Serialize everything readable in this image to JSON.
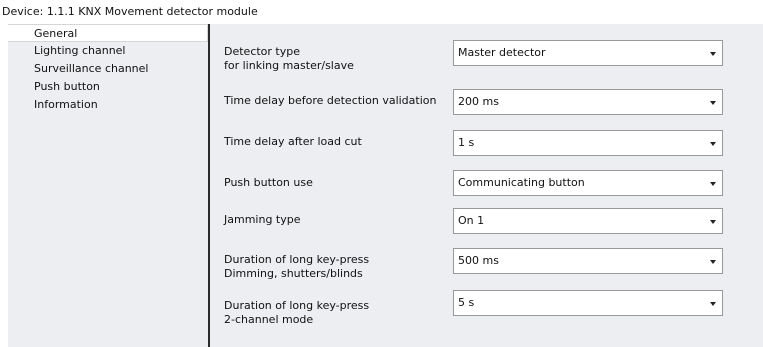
{
  "window": {
    "title": "Device: 1.1.1  KNX Movement detector module"
  },
  "sidebar": {
    "items": [
      {
        "label": "General"
      },
      {
        "label": "Lighting channel"
      },
      {
        "label": "Surveillance channel"
      },
      {
        "label": "Push button"
      },
      {
        "label": "Information"
      }
    ],
    "selected": "General"
  },
  "parameters": [
    {
      "label_line1": "Detector type",
      "label_line2": "for linking master/slave",
      "value": "Master detector"
    },
    {
      "label_line1": "Time delay before detection validation",
      "label_line2": "",
      "value": "200 ms"
    },
    {
      "label_line1": "Time delay after load cut",
      "label_line2": "",
      "value": "1 s"
    },
    {
      "label_line1": "Push button use",
      "label_line2": "",
      "value": "Communicating button"
    },
    {
      "label_line1": "Jamming type",
      "label_line2": "",
      "value": "On 1"
    },
    {
      "label_line1": "Duration of long key-press",
      "label_line2": "Dimming, shutters/blinds",
      "value": "500 ms"
    },
    {
      "label_line1": "Duration of long key-press",
      "label_line2": "2-channel mode",
      "value": "5 s"
    }
  ],
  "icons": {
    "dropdown": "chevron-down-icon"
  },
  "colors": {
    "panel_background": "#eceef1",
    "divider": "#2b2b2b",
    "field_border": "#9a9a9a"
  }
}
